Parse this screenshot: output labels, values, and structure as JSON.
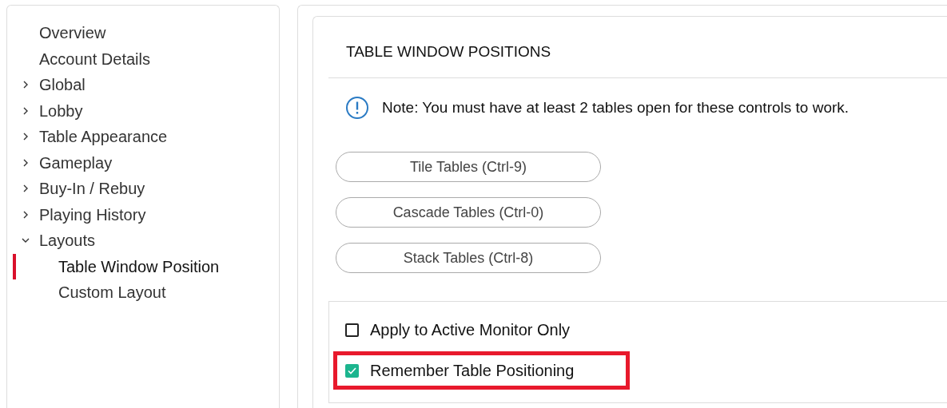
{
  "sidebar": {
    "items": [
      {
        "label": "Overview",
        "kind": "leaf",
        "selected": false
      },
      {
        "label": "Account Details",
        "kind": "leaf",
        "selected": false
      },
      {
        "label": "Global",
        "kind": "group",
        "expanded": false,
        "selected": false
      },
      {
        "label": "Lobby",
        "kind": "group",
        "expanded": false,
        "selected": false
      },
      {
        "label": "Table Appearance",
        "kind": "group",
        "expanded": false,
        "selected": false
      },
      {
        "label": "Gameplay",
        "kind": "group",
        "expanded": false,
        "selected": false
      },
      {
        "label": "Buy-In / Rebuy",
        "kind": "group",
        "expanded": false,
        "selected": false
      },
      {
        "label": "Playing History",
        "kind": "group",
        "expanded": false,
        "selected": false
      },
      {
        "label": "Layouts",
        "kind": "group",
        "expanded": true,
        "selected": false,
        "children": [
          {
            "label": "Table Window Position",
            "selected": true
          },
          {
            "label": "Custom Layout",
            "selected": false
          }
        ]
      }
    ]
  },
  "section": {
    "title": "TABLE WINDOW POSITIONS",
    "note": "Note: You must have at least 2 tables open for these controls to work.",
    "buttons": [
      "Tile Tables (Ctrl-9)",
      "Cascade Tables (Ctrl-0)",
      "Stack Tables (Ctrl-8)"
    ],
    "options": [
      {
        "label": "Apply to Active Monitor Only",
        "checked": false,
        "highlighted": false
      },
      {
        "label": "Remember Table Positioning",
        "checked": true,
        "highlighted": true
      }
    ]
  }
}
